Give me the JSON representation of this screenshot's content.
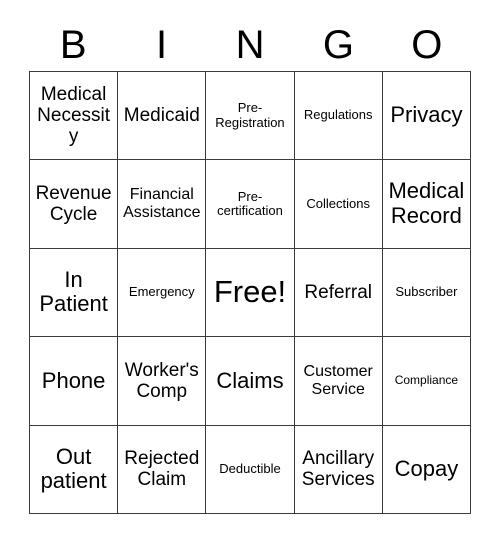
{
  "card": {
    "title_letters": [
      "B",
      "I",
      "N",
      "G",
      "O"
    ],
    "colors": {
      "background": "#ffffff",
      "text": "#000000",
      "grid_line": "#3b3b3b"
    },
    "rows": [
      [
        {
          "label": "Medical\nNecessity",
          "size": "md"
        },
        {
          "label": "Medicaid",
          "size": "md"
        },
        {
          "label": "Pre-\nRegistration",
          "size": "xs"
        },
        {
          "label": "Regulations",
          "size": "xs"
        },
        {
          "label": "Privacy",
          "size": "lg"
        }
      ],
      [
        {
          "label": "Revenue\nCycle",
          "size": "md"
        },
        {
          "label": "Financial\nAssistance",
          "size": "sm"
        },
        {
          "label": "Pre-\ncertification",
          "size": "xs"
        },
        {
          "label": "Collections",
          "size": "xs"
        },
        {
          "label": "Medical\nRecord",
          "size": "lg"
        }
      ],
      [
        {
          "label": "In\nPatient",
          "size": "lg"
        },
        {
          "label": "Emergency",
          "size": "xs"
        },
        {
          "label": "Free!",
          "size": "xl"
        },
        {
          "label": "Referral",
          "size": "md"
        },
        {
          "label": "Subscriber",
          "size": "xs"
        }
      ],
      [
        {
          "label": "Phone",
          "size": "lg"
        },
        {
          "label": "Worker's\nComp",
          "size": "md"
        },
        {
          "label": "Claims",
          "size": "lg"
        },
        {
          "label": "Customer\nService",
          "size": "sm"
        },
        {
          "label": "Compliance",
          "size": "xxs"
        }
      ],
      [
        {
          "label": "Out\npatient",
          "size": "lg"
        },
        {
          "label": "Rejected\nClaim",
          "size": "md"
        },
        {
          "label": "Deductible",
          "size": "xs"
        },
        {
          "label": "Ancillary\nServices",
          "size": "md"
        },
        {
          "label": "Copay",
          "size": "lg"
        }
      ]
    ]
  }
}
